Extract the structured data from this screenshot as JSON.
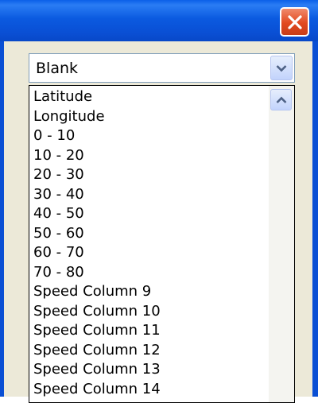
{
  "titlebar": {
    "close_icon": "close-icon"
  },
  "combo": {
    "selected": "Blank"
  },
  "list": {
    "items": [
      "Latitude",
      "Longitude",
      "0 - 10",
      "10 - 20",
      "20 - 30",
      "30 - 40",
      "40 - 50",
      "50 - 60",
      "60 - 70",
      "70 - 80",
      "Speed Column 9",
      "Speed Column 10",
      "Speed Column 11",
      "Speed Column 12",
      "Speed Column 13",
      "Speed Column 14"
    ]
  },
  "colors": {
    "titlebar": "#0a5fe8",
    "close_button": "#e2491f",
    "client_bg": "#ece9d8"
  }
}
